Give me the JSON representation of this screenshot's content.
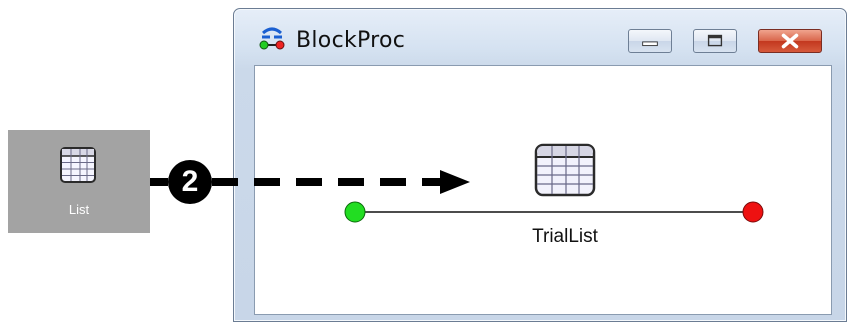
{
  "source_tile": {
    "label": "List",
    "icon": "list-table-icon"
  },
  "annotation": {
    "step_number": "2"
  },
  "window": {
    "title": "BlockProc",
    "app_icon": "blockproc-flow-icon",
    "controls": {
      "minimize": "minimize-icon",
      "maximize": "maximize-icon",
      "close": "close-icon"
    }
  },
  "canvas": {
    "node": {
      "label": "TrialList",
      "icon": "list-table-icon"
    },
    "start_node_color": "#22dd22",
    "end_node_color": "#ee1111"
  }
}
